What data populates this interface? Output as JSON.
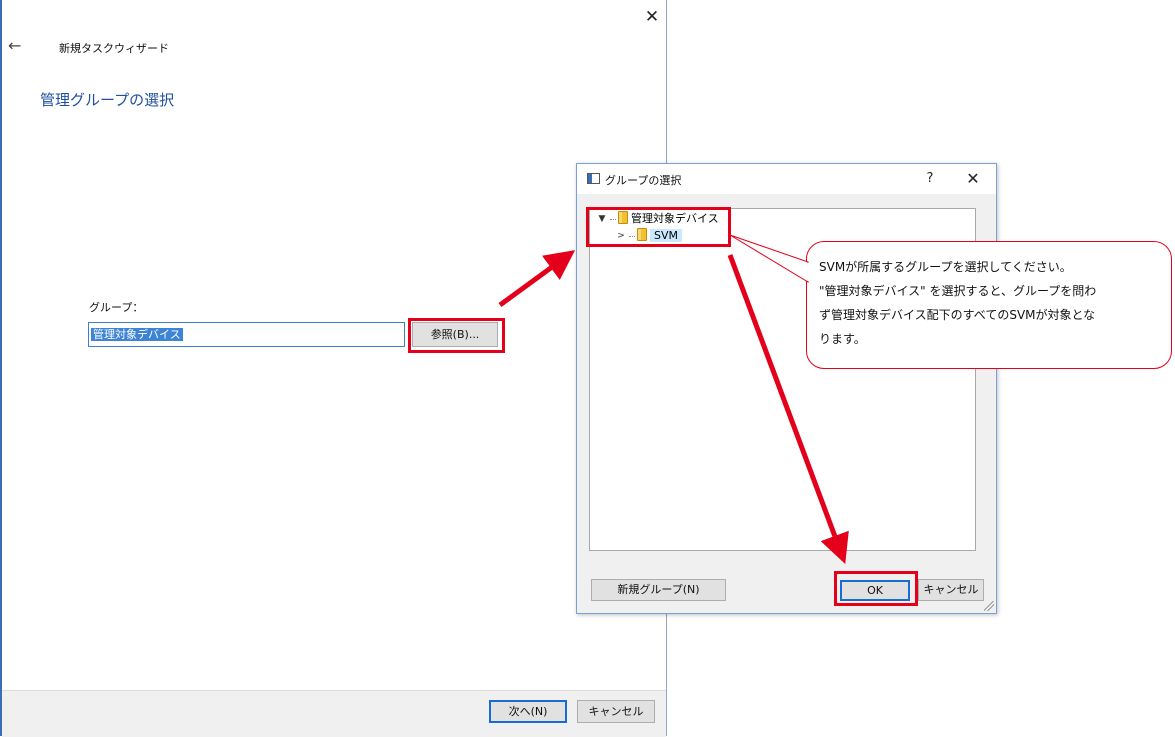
{
  "wizard": {
    "title": "新規タスクウィザード",
    "heading": "管理グループの選択",
    "group_label": "グループ：",
    "group_value": "管理対象デバイス",
    "browse_label": "参照(B)...",
    "next_label": "次へ(N)",
    "cancel_label": "キャンセル",
    "back_icon": "arrow-left-icon",
    "close_icon": "close-icon"
  },
  "dialog": {
    "title": "グループの選択",
    "help_label": "?",
    "tree": {
      "root_label": "管理対象デバイス",
      "child_label": "SVM"
    },
    "new_group_label": "新規グループ(N)",
    "ok_label": "OK",
    "cancel_label": "キャンセル"
  },
  "callout": {
    "lines": [
      "SVMが所属するグループを選択してください。",
      "\"管理対象デバイス\" を選択すると、グループを問わ",
      "ず管理対象デバイス配下のすべてのSVMが対象とな",
      "ります。"
    ]
  },
  "colors": {
    "accent_blue": "#1f4f9e",
    "selection_blue": "#3d83d6",
    "annotation_red": "#e4001b",
    "button_face": "#e1e1e1",
    "dialog_bg": "#f0f0f0"
  }
}
